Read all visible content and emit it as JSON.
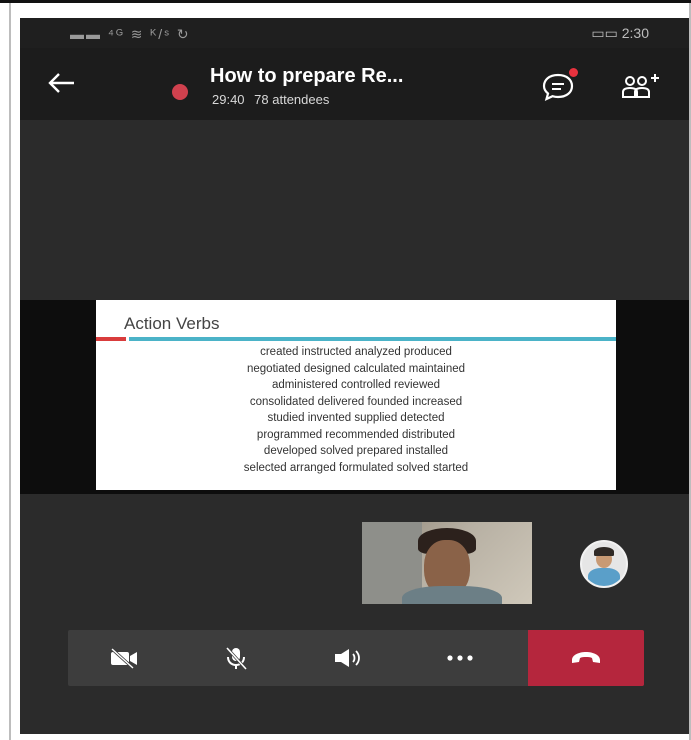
{
  "status_bar": {
    "left": "▬▬ ⁴ᴳ ≋ ᴷ/ˢ ↻",
    "right": "▭▭ 2:30"
  },
  "meeting": {
    "title": "How to prepare Re...",
    "duration": "29:40",
    "attendees": "78 attendees"
  },
  "slide": {
    "title": "Action Verbs",
    "lines": [
      "created  instructed  analyzed  produced",
      "negotiated  designed  calculated  maintained",
      "administered  controlled  reviewed",
      "consolidated  delivered  founded  increased",
      "studied  invented  supplied  detected",
      "programmed  recommended  distributed",
      "developed  solved  prepared  installed",
      "selected arranged  formulated  solved  started"
    ]
  },
  "icons": {
    "back": "back-arrow-icon",
    "recording": "recording-dot-icon",
    "chat": "chat-icon",
    "participants": "add-people-icon",
    "camera": "camera-off-icon",
    "mic": "mic-off-icon",
    "speaker": "speaker-icon",
    "more": "more-icon",
    "hangup": "hang-up-icon"
  },
  "colors": {
    "hangup": "#b5263d",
    "recording": "#d0414e",
    "slide_accent_blue": "#4bb3c8",
    "slide_accent_red": "#d93c3c"
  }
}
